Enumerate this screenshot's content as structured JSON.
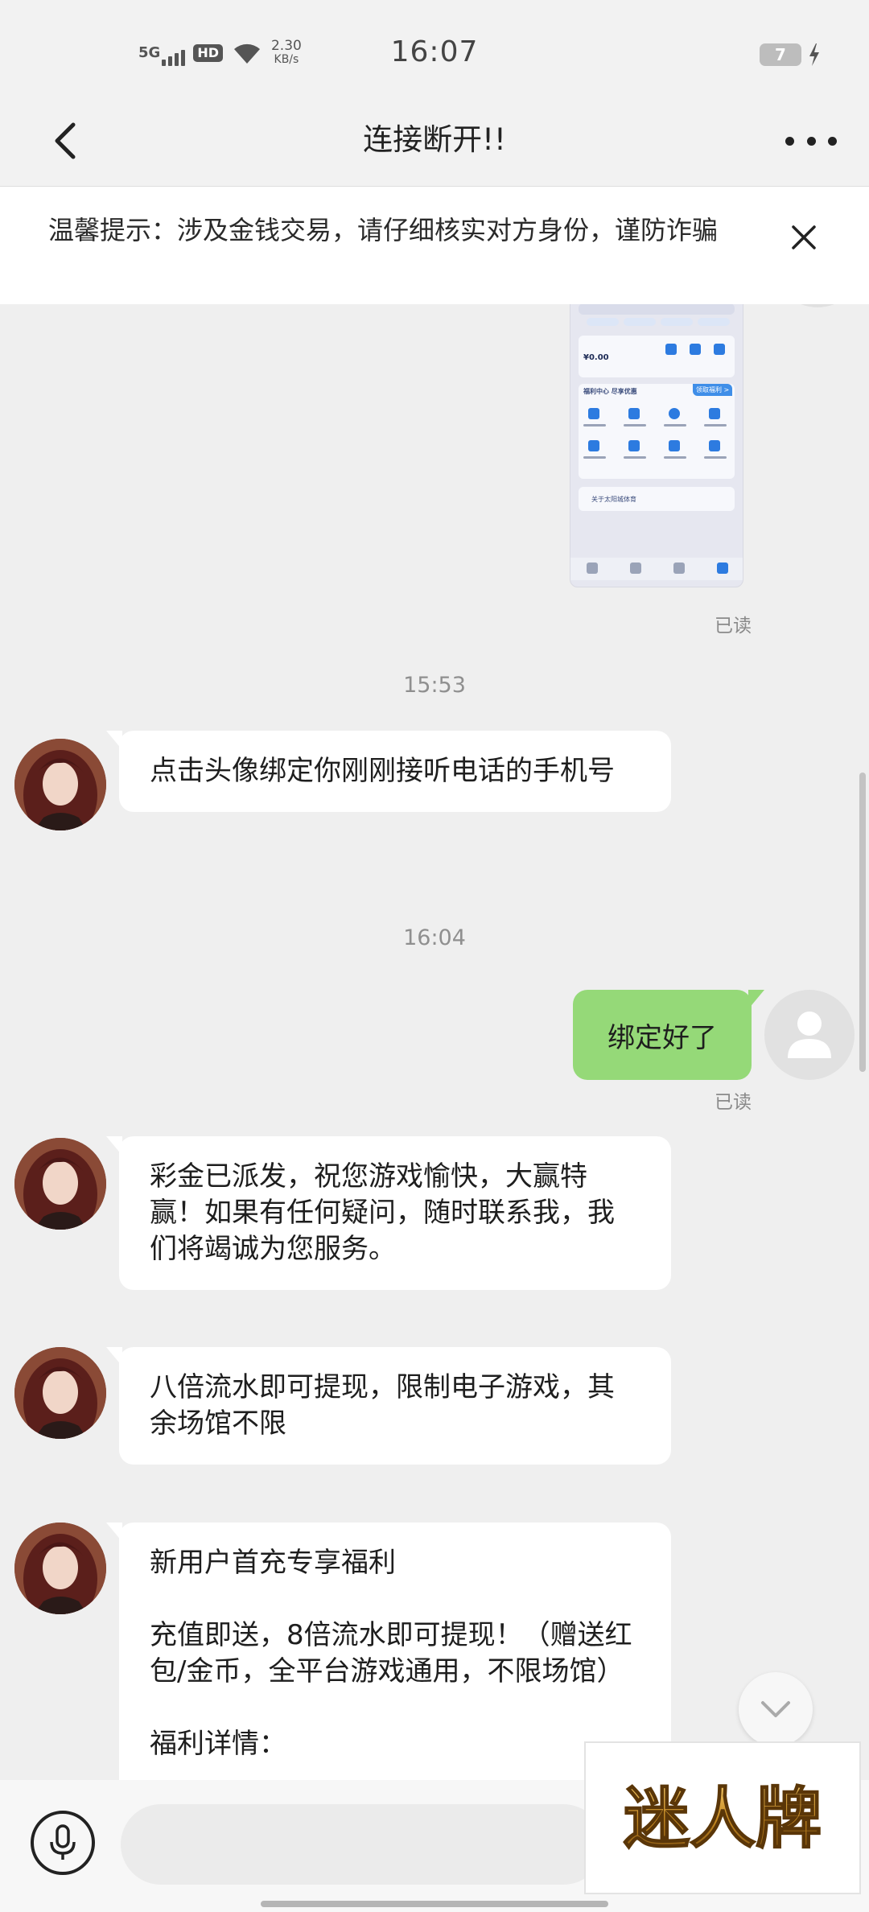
{
  "status_bar": {
    "network": "5G",
    "hd": "HD",
    "speed_value": "2.30",
    "speed_unit": "KB/s",
    "time": "16:07",
    "battery": "7"
  },
  "header": {
    "title": "连接断开!!"
  },
  "notice": {
    "text": "温馨提示：涉及金钱交易，请仔细核实对方身份，谨防诈骗"
  },
  "messages": {
    "read_label": "已读",
    "timestamp_1": "15:53",
    "msg_1": "点击头像绑定你刚刚接听电话的手机号",
    "timestamp_2": "16:04",
    "my_msg": "绑定好了",
    "msg_2": "彩金已派发，祝您游戏愉快，大赢特赢！如果有任何疑问，随时联系我，我们将竭诚为您服务。",
    "msg_3": "八倍流水即可提现，限制电子游戏，其余场馆不限",
    "msg_4": "新用户首充专享福利\n\n充值即送，8倍流水即可提现！（赠送红包/金币，全平台游戏通用，不限场馆）\n\n福利详情："
  },
  "screenshot_preview": {
    "balance": "¥0.00",
    "section_title": "福利中心  尽享优惠",
    "badge": "领取福利 >",
    "link_text": "关于太阳城体育"
  },
  "watermark": {
    "text": "迷人牌"
  },
  "colors": {
    "my_bubble": "#95d978",
    "background": "#efefef"
  }
}
